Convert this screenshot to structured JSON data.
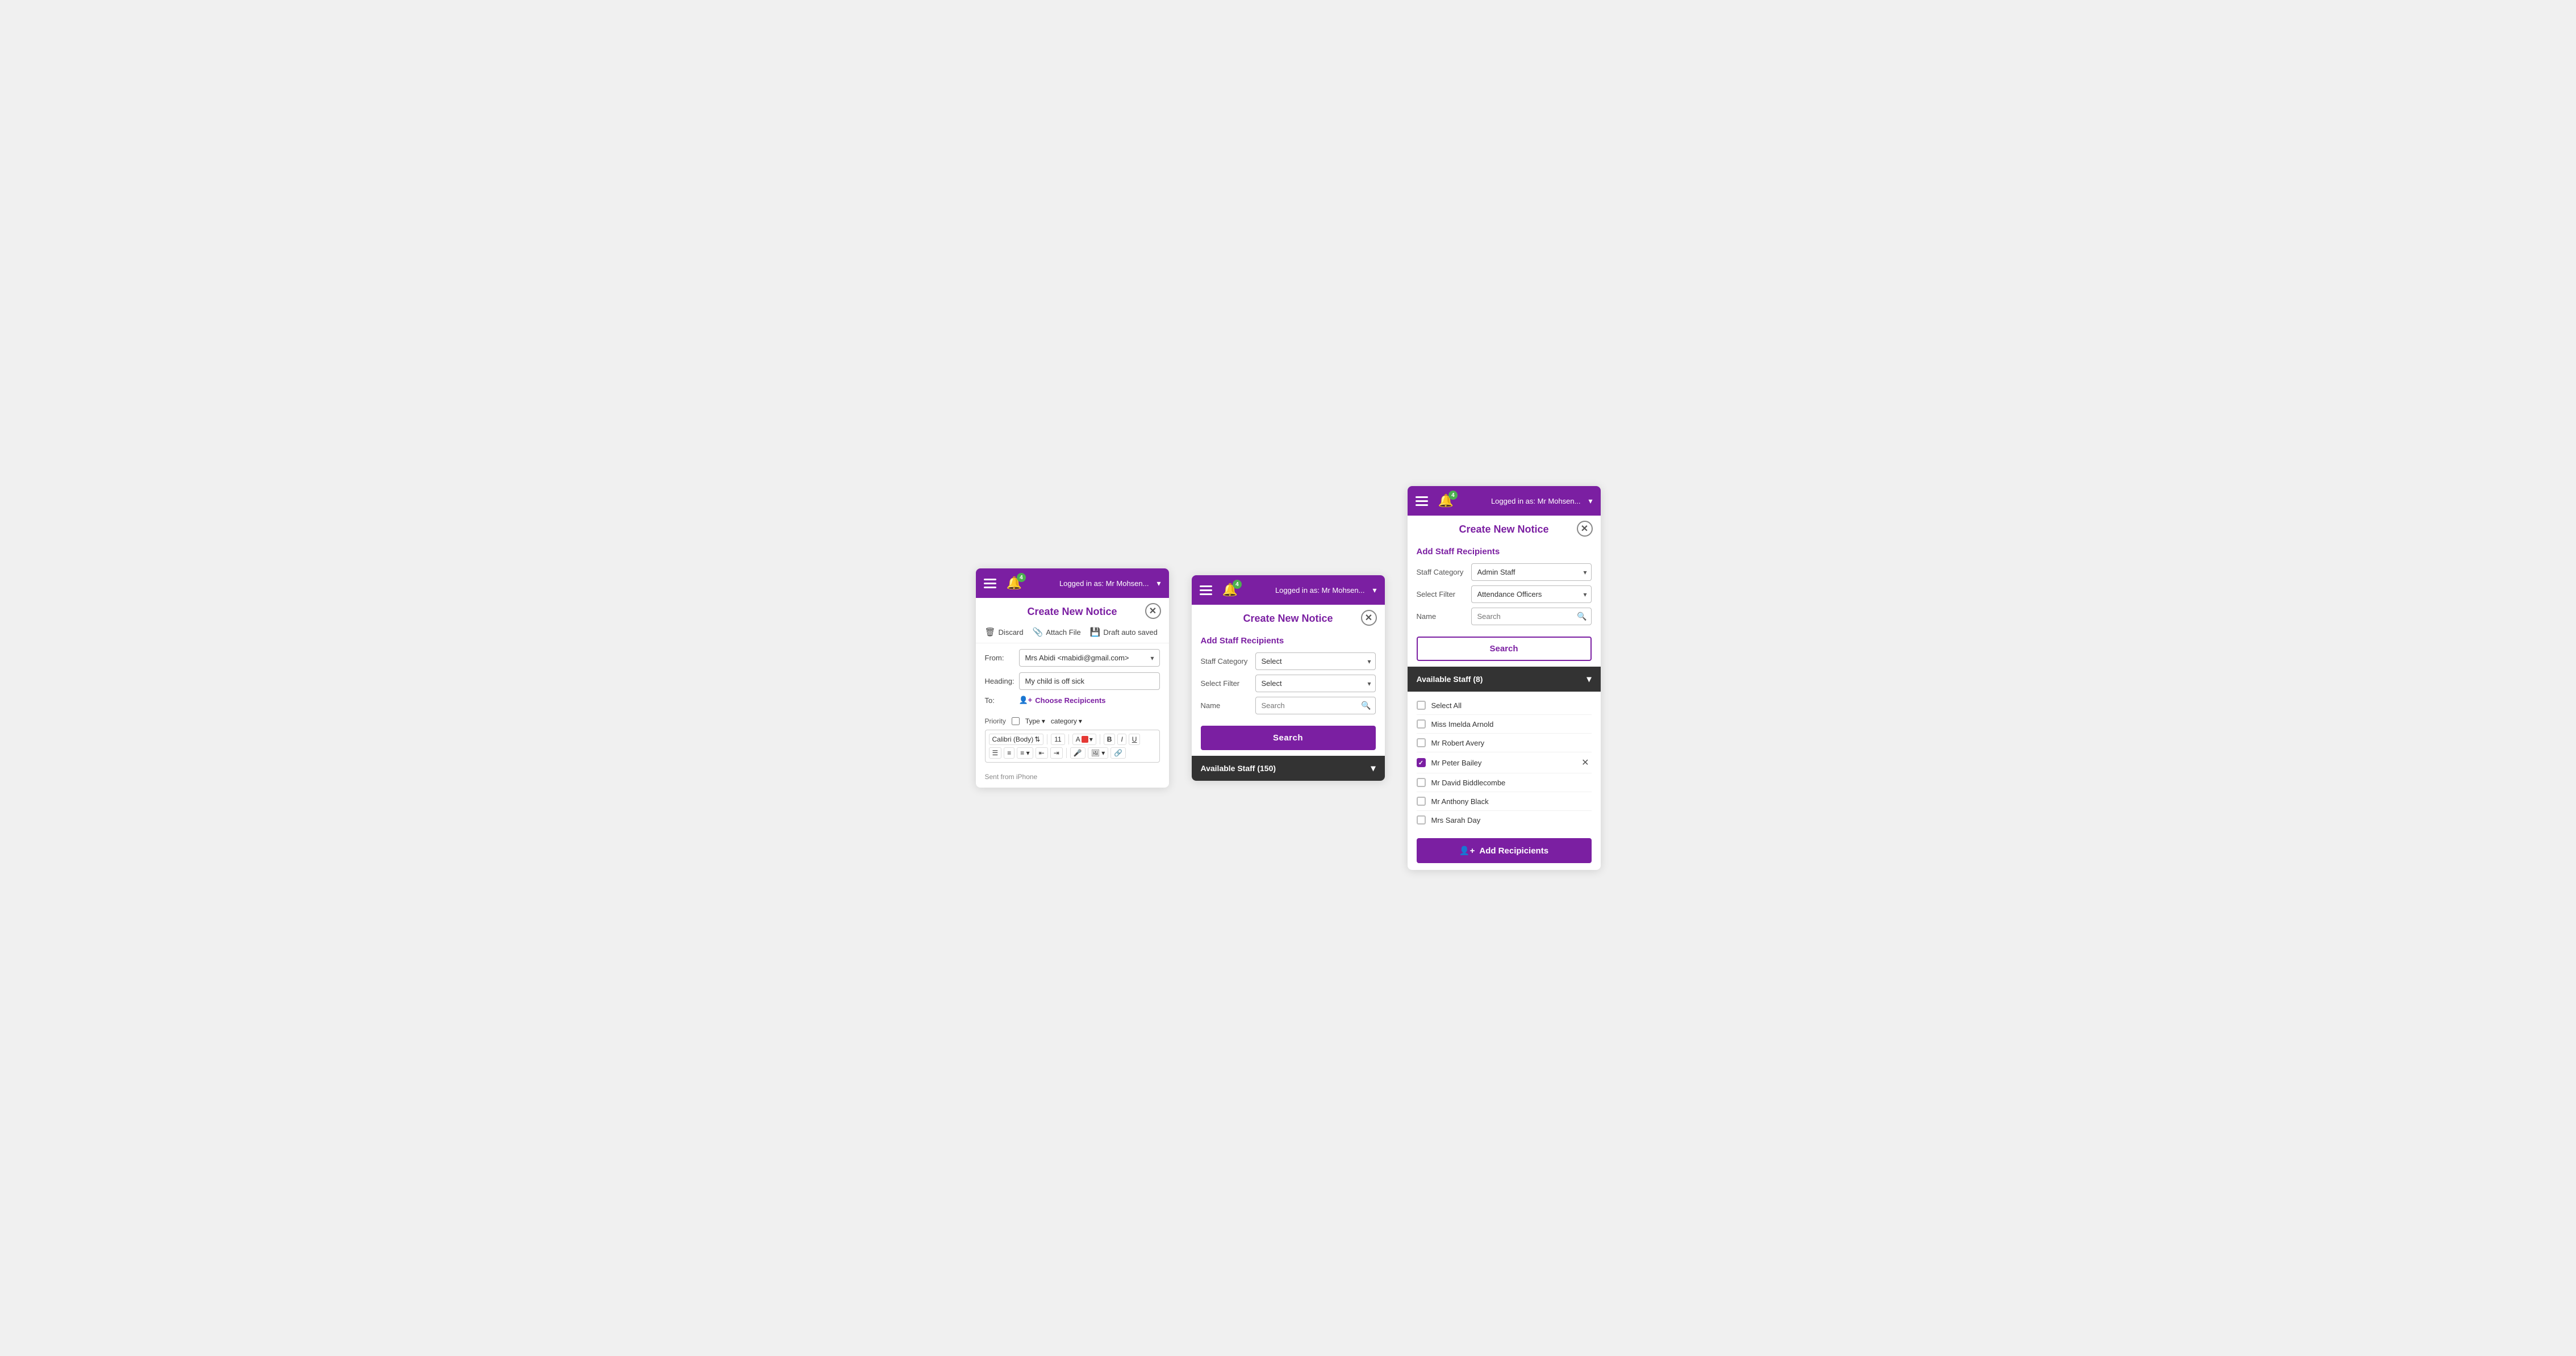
{
  "header": {
    "bell_badge": "4",
    "logged_in_text": "Logged in as: Mr Mohsen...",
    "chevron": "▾"
  },
  "panel1": {
    "title": "Create New Notice",
    "toolbar": {
      "discard": "Discard",
      "attach_file": "Attach File",
      "draft_auto_saved": "Draft auto saved"
    },
    "from_label": "From:",
    "from_value": "Mrs Abidi <mabidi@gmail.com>",
    "heading_label": "Heading:",
    "heading_value": "My child is off sick",
    "to_label": "To:",
    "choose_recipients": "Choose Recipicents",
    "priority_label": "Priority",
    "type_label": "Type",
    "type_arrow": "▾",
    "category_label": "category",
    "category_arrow": "▾",
    "font_name": "Calibri (Body)",
    "font_size": "11",
    "bold": "B",
    "italic": "I",
    "underline": "U",
    "footer_text": "Sent from iPhone"
  },
  "panel2": {
    "title": "Create New Notice",
    "sub_title": "Add Staff Recipients",
    "staff_category_label": "Staff Category",
    "staff_category_value": "Select",
    "select_filter_label": "Select Filter",
    "select_filter_value": "Select",
    "name_label": "Name",
    "name_placeholder": "Search",
    "search_btn": "Search",
    "avail_staff_label": "Available Staff (150)",
    "avail_chevron": "▾"
  },
  "panel3": {
    "title": "Create New Notice",
    "sub_title": "Add Staff Recipients",
    "staff_category_label": "Staff Category",
    "staff_category_value": "Admin Staff",
    "select_filter_label": "Select Filter",
    "select_filter_value": "Attendance Officers",
    "name_label": "Name",
    "name_placeholder": "Search",
    "search_btn": "Search",
    "avail_staff_label": "Available Staff (8)",
    "avail_chevron": "▾",
    "staff_list": [
      {
        "name": "Select All",
        "checked": false,
        "id": "select-all"
      },
      {
        "name": "Miss Imelda Arnold",
        "checked": false,
        "id": "imelda-arnold"
      },
      {
        "name": "Mr Robert Avery",
        "checked": false,
        "id": "robert-avery"
      },
      {
        "name": "Mr Peter Bailey",
        "checked": true,
        "id": "peter-bailey",
        "removable": true
      },
      {
        "name": "Mr David Biddlecombe",
        "checked": false,
        "id": "david-biddlecombe"
      },
      {
        "name": "Mr Anthony Black",
        "checked": false,
        "id": "anthony-black"
      },
      {
        "name": "Mrs Sarah Day",
        "checked": false,
        "id": "sarah-day"
      }
    ],
    "add_btn_icon": "👤+",
    "add_btn_label": "Add Recipicients"
  },
  "colors": {
    "purple": "#7b1fa2",
    "dark_bar": "#333333",
    "green_badge": "#4caf50"
  }
}
